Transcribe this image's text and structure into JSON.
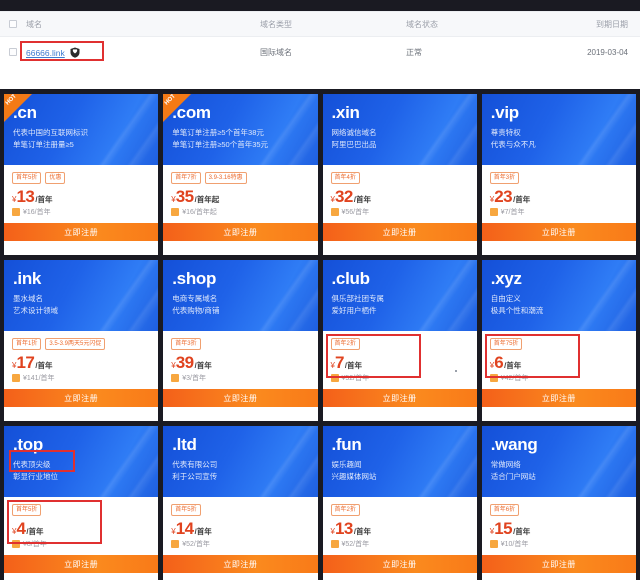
{
  "table": {
    "headers": [
      "域名",
      "域名类型",
      "域名状态",
      "到期日期"
    ],
    "row": {
      "domain": "66666.link",
      "type": "国际域名",
      "status": "正常",
      "expiry": "2019-03-04",
      "badge_icon": "shield-icon"
    }
  },
  "colors": {
    "highlight": "#e03030",
    "price": "#e0431f",
    "card_blue": "#1f62e8",
    "button_orange": "#f97a18",
    "link_blue": "#3e7bd0"
  },
  "cards": [
    {
      "tld": ".cn",
      "hot": true,
      "hot_label": "HOT",
      "desc": [
        "代表中国的互联网标识",
        "单笔订单注册量≥5"
      ],
      "tags": [
        "首年5折",
        "优惠"
      ],
      "currency": "¥",
      "price": "13",
      "per": "/首年",
      "original": "¥16/首年",
      "button": "立即注册",
      "highlight": "none"
    },
    {
      "tld": ".com",
      "hot": true,
      "hot_label": "HOT",
      "desc": [
        "单笔订单注册≥5个首年38元",
        "单笔订单注册≥50个首年35元"
      ],
      "tags": [
        "首年7折",
        "3.9-3.16特惠"
      ],
      "currency": "¥",
      "price": "35",
      "per": "/首年起",
      "original": "¥16/首年起",
      "button": "立即注册",
      "highlight": "none"
    },
    {
      "tld": ".xin",
      "hot": false,
      "hot_label": "",
      "desc": [
        "网络诚信域名",
        "阿里巴巴出品"
      ],
      "tags": [
        "首年4折"
      ],
      "currency": "¥",
      "price": "32",
      "per": "/首年",
      "original": "¥56/首年",
      "button": "立即注册",
      "highlight": "none"
    },
    {
      "tld": ".vip",
      "hot": false,
      "hot_label": "",
      "desc": [
        "尊贵特权",
        "代表与众不凡"
      ],
      "tags": [
        "首年3折"
      ],
      "currency": "¥",
      "price": "23",
      "per": "/首年",
      "original": "¥7/首年",
      "button": "立即注册",
      "highlight": "none"
    },
    {
      "tld": ".ink",
      "hot": false,
      "hot_label": "",
      "desc": [
        "墨水域名",
        "艺术设计领域"
      ],
      "tags": [
        "首年1折",
        "3.5-3.9两天5元闪促"
      ],
      "currency": "¥",
      "price": "17",
      "per": "/首年",
      "original": "¥141/首年",
      "button": "立即注册",
      "highlight": "none"
    },
    {
      "tld": ".shop",
      "hot": false,
      "hot_label": "",
      "desc": [
        "电商专属域名",
        "代表购物/商铺"
      ],
      "tags": [
        "首年3折"
      ],
      "currency": "¥",
      "price": "39",
      "per": "/首年",
      "original": "¥3/首年",
      "button": "立即注册",
      "highlight": "none"
    },
    {
      "tld": ".club",
      "hot": false,
      "hot_label": "",
      "desc": [
        "俱乐部社团专属",
        "爱好用户栖件"
      ],
      "tags": [
        "首年2折"
      ],
      "currency": "¥",
      "price": "7",
      "per": "/首年",
      "original": "¥52/首年",
      "button": "立即注册",
      "highlight": "price"
    },
    {
      "tld": ".xyz",
      "hot": false,
      "hot_label": "",
      "desc": [
        "自由定义",
        "极具个性和潮流"
      ],
      "tags": [
        "首年75折"
      ],
      "currency": "¥",
      "price": "6",
      "per": "/首年",
      "original": "¥42/首年",
      "button": "立即注册",
      "highlight": "price-narrow"
    },
    {
      "tld": ".top",
      "hot": false,
      "hot_label": "",
      "desc": [
        "代表顶尖级",
        "彰显行业地位"
      ],
      "tags": [
        "首年5折"
      ],
      "currency": "¥",
      "price": "4",
      "per": "/首年",
      "original": "¥8/首年",
      "button": "立即注册",
      "highlight": "tld-and-price"
    },
    {
      "tld": ".ltd",
      "hot": false,
      "hot_label": "",
      "desc": [
        "代表有限公司",
        "利于公司宣传"
      ],
      "tags": [
        "首年5折"
      ],
      "currency": "¥",
      "price": "14",
      "per": "/首年",
      "original": "¥52/首年",
      "button": "立即注册",
      "highlight": "none"
    },
    {
      "tld": ".fun",
      "hot": false,
      "hot_label": "",
      "desc": [
        "娱乐趣闻",
        "兴趣媒体网站"
      ],
      "tags": [
        "首年2折"
      ],
      "currency": "¥",
      "price": "13",
      "per": "/首年",
      "original": "¥52/首年",
      "button": "立即注册",
      "highlight": "none"
    },
    {
      "tld": ".wang",
      "hot": false,
      "hot_label": "",
      "desc": [
        "常做网络",
        "适合门户网站"
      ],
      "tags": [
        "首年6折"
      ],
      "currency": "¥",
      "price": "15",
      "per": "/首年",
      "original": "¥10/首年",
      "button": "立即注册",
      "highlight": "none"
    }
  ]
}
